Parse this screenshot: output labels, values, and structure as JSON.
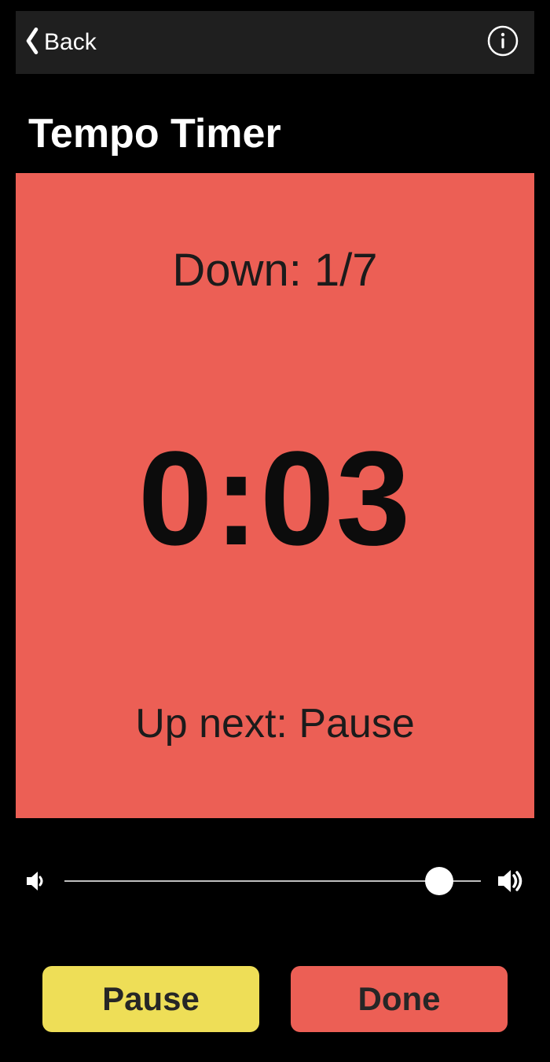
{
  "header": {
    "back_label": "Back"
  },
  "title": "Tempo Timer",
  "card": {
    "phase_label": "Down: 1/7",
    "time": "0:03",
    "upnext_label": "Up next: Pause",
    "bg_color": "#ec5f55"
  },
  "volume": {
    "value_percent": 90
  },
  "buttons": {
    "pause_label": "Pause",
    "done_label": "Done"
  },
  "colors": {
    "accent_red": "#ec5f55",
    "accent_yellow": "#eede57"
  }
}
